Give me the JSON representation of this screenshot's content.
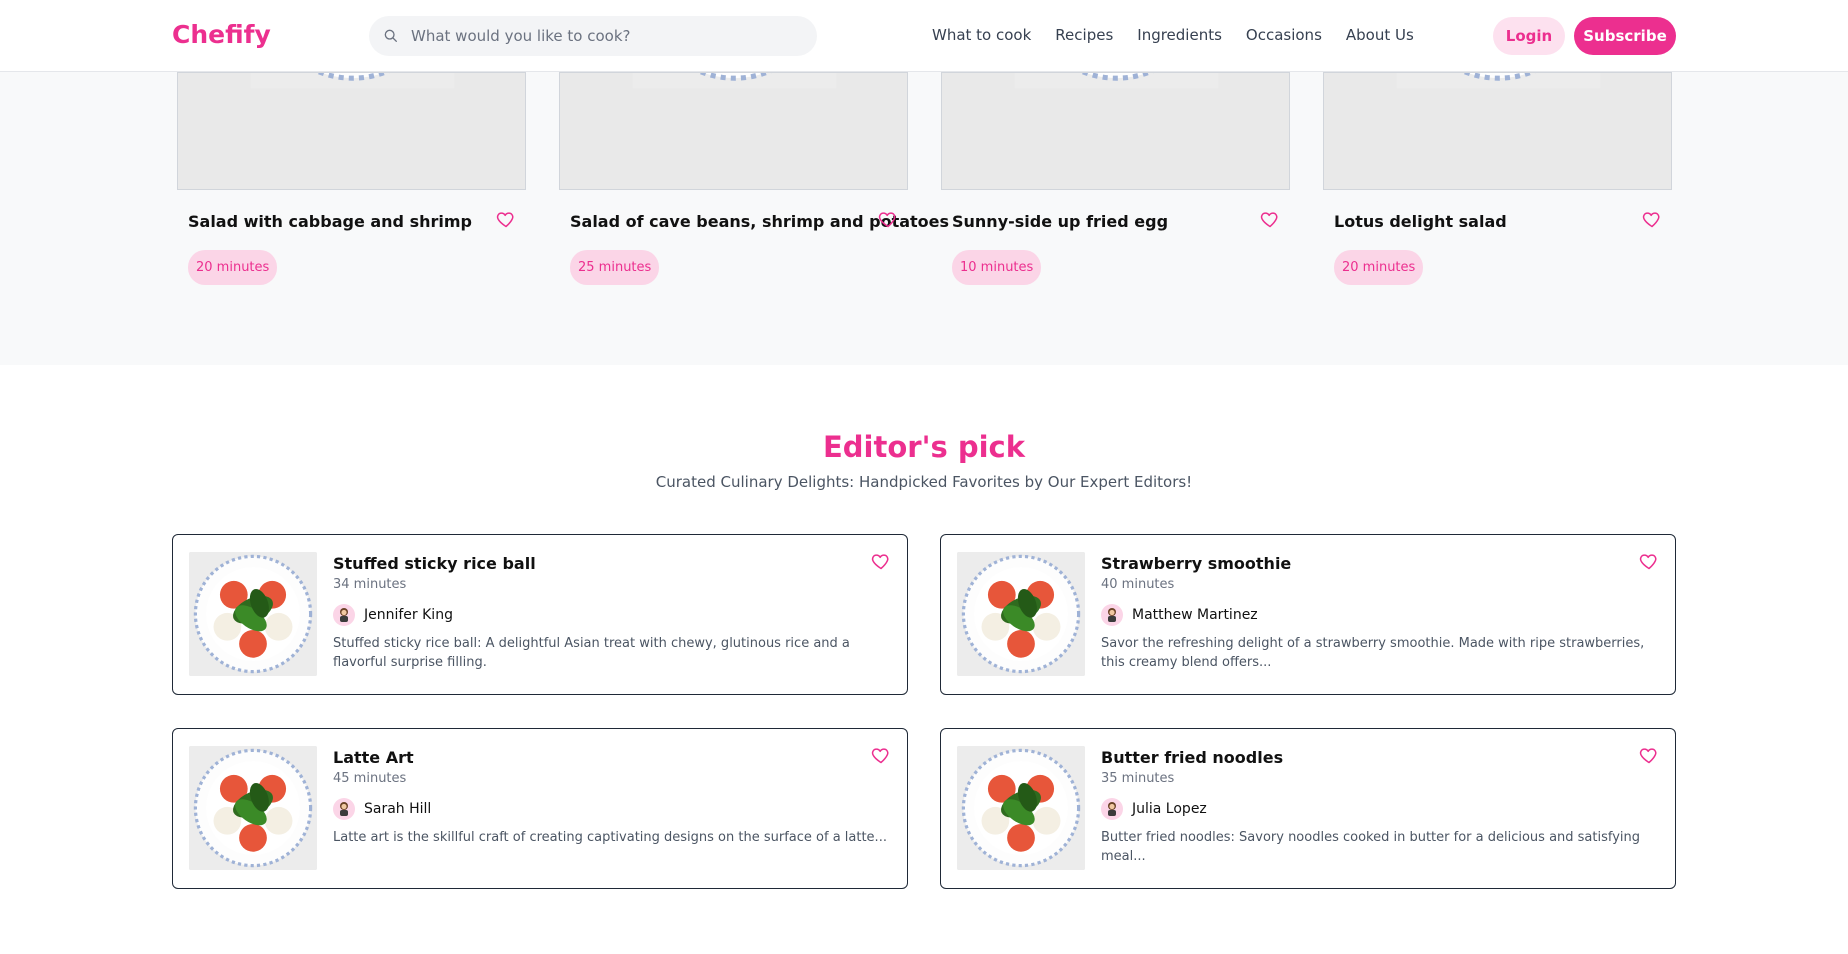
{
  "header": {
    "logo": "Chefify",
    "search_placeholder": "What would you like to cook?",
    "nav": [
      "What to cook",
      "Recipes",
      "Ingredients",
      "Occasions",
      "About Us"
    ],
    "login_label": "Login",
    "subscribe_label": "Subscribe"
  },
  "recipes": [
    {
      "title": "Salad with cabbage and shrimp",
      "time": "20 minutes"
    },
    {
      "title": "Salad of cave beans, shrimp and potatoes",
      "time": "25 minutes"
    },
    {
      "title": "Sunny-side up fried egg",
      "time": "10 minutes"
    },
    {
      "title": "Lotus delight salad",
      "time": "20 minutes"
    }
  ],
  "editors_pick": {
    "title": "Editor's pick",
    "subtitle": "Curated Culinary Delights: Handpicked Favorites by Our Expert Editors!",
    "cards": [
      {
        "title": "Stuffed sticky rice ball",
        "time": "34 minutes",
        "author": "Jennifer King",
        "desc": "Stuffed sticky rice ball: A delightful Asian treat with chewy, glutinous rice and a flavorful surprise filling."
      },
      {
        "title": "Strawberry smoothie",
        "time": "40 minutes",
        "author": "Matthew Martinez",
        "desc": "Savor the refreshing delight of a strawberry smoothie. Made with ripe strawberries, this creamy blend offers..."
      },
      {
        "title": "Latte Art",
        "time": "45 minutes",
        "author": "Sarah Hill",
        "desc": "Latte art is the skillful craft of creating captivating designs on the surface of a latte..."
      },
      {
        "title": "Butter fried noodles",
        "time": "35 minutes",
        "author": "Julia Lopez",
        "desc": "Butter fried noodles: Savory noodles cooked in butter for a delicious and satisfying meal..."
      }
    ]
  },
  "colors": {
    "brand": "#ec2f8f",
    "brand_light": "#fbd5e7"
  }
}
